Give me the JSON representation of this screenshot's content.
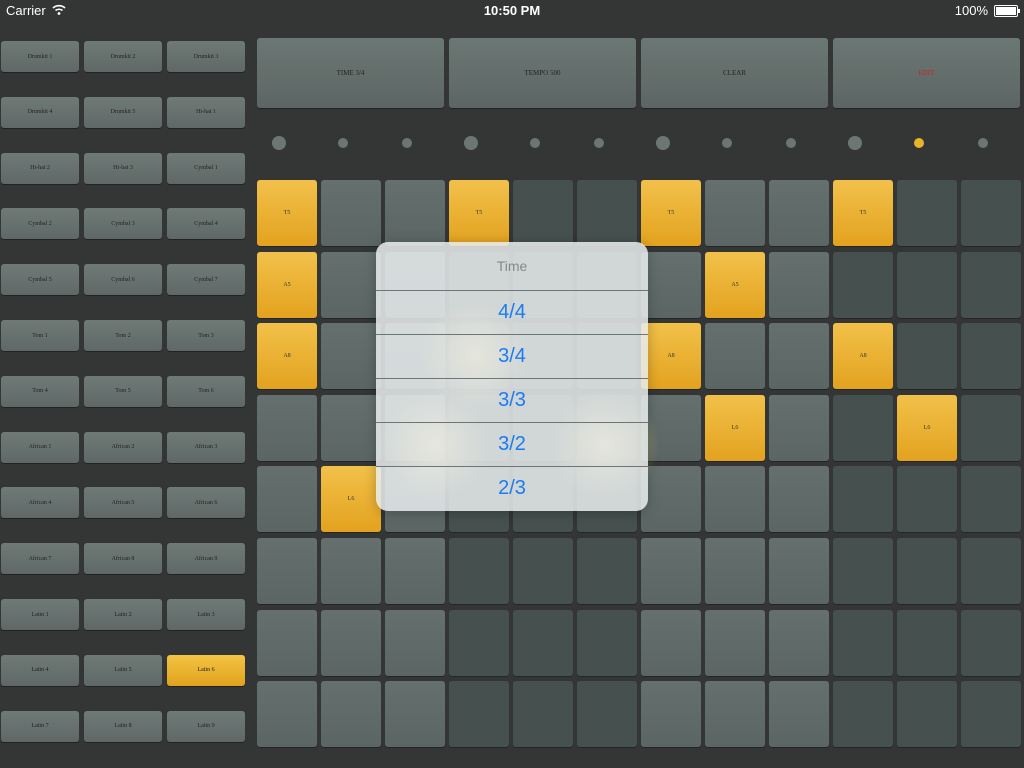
{
  "status": {
    "carrier": "Carrier",
    "time": "10:50 PM",
    "battery": "100%"
  },
  "instruments": [
    "Drumkit 1",
    "Drumkit 2",
    "Drumkit 3",
    "Drumkit 4",
    "Drumkit 5",
    "Hi-hat 1",
    "Hi-hat 2",
    "Hi-hat 3",
    "Cymbal 1",
    "Cymbal 2",
    "Cymbal 3",
    "Cymbal 4",
    "Cymbal 5",
    "Cymbal 6",
    "Cymbal 7",
    "Tom 1",
    "Tom 2",
    "Tom 3",
    "Tom 4",
    "Tom 5",
    "Tom 6",
    "African 1",
    "African 2",
    "African 3",
    "African 4",
    "African 5",
    "African 6",
    "African 7",
    "African 8",
    "African 9",
    "Latin 1",
    "Latin 2",
    "Latin 3",
    "Latin 4",
    "Latin 5",
    "Latin 6",
    "Latin 7",
    "Latin 8",
    "Latin 9"
  ],
  "selected_instrument": "Latin 6",
  "controls": {
    "time": "TIME 3/4",
    "tempo": "TEMPO 500",
    "clear": "CLEAR",
    "edit": "EDIT"
  },
  "beat_indicators": {
    "count": 12,
    "active_step": 11,
    "accented_steps": [
      1,
      4,
      7,
      10
    ]
  },
  "grid": {
    "rows": 8,
    "cols": 12,
    "active_cells": [
      {
        "row": 1,
        "col": 1,
        "label": "T5"
      },
      {
        "row": 1,
        "col": 4,
        "label": "T5"
      },
      {
        "row": 1,
        "col": 7,
        "label": "T5"
      },
      {
        "row": 1,
        "col": 10,
        "label": "T5"
      },
      {
        "row": 2,
        "col": 1,
        "label": "A5"
      },
      {
        "row": 2,
        "col": 8,
        "label": "A5"
      },
      {
        "row": 3,
        "col": 1,
        "label": "A8"
      },
      {
        "row": 3,
        "col": 7,
        "label": "A8"
      },
      {
        "row": 3,
        "col": 10,
        "label": "A8"
      },
      {
        "row": 4,
        "col": 8,
        "label": "L6"
      },
      {
        "row": 4,
        "col": 11,
        "label": "L6"
      },
      {
        "row": 5,
        "col": 2,
        "label": "L6"
      }
    ]
  },
  "time_picker": {
    "title": "Time",
    "options": [
      "4/4",
      "3/4",
      "3/3",
      "3/2",
      "2/3"
    ]
  }
}
